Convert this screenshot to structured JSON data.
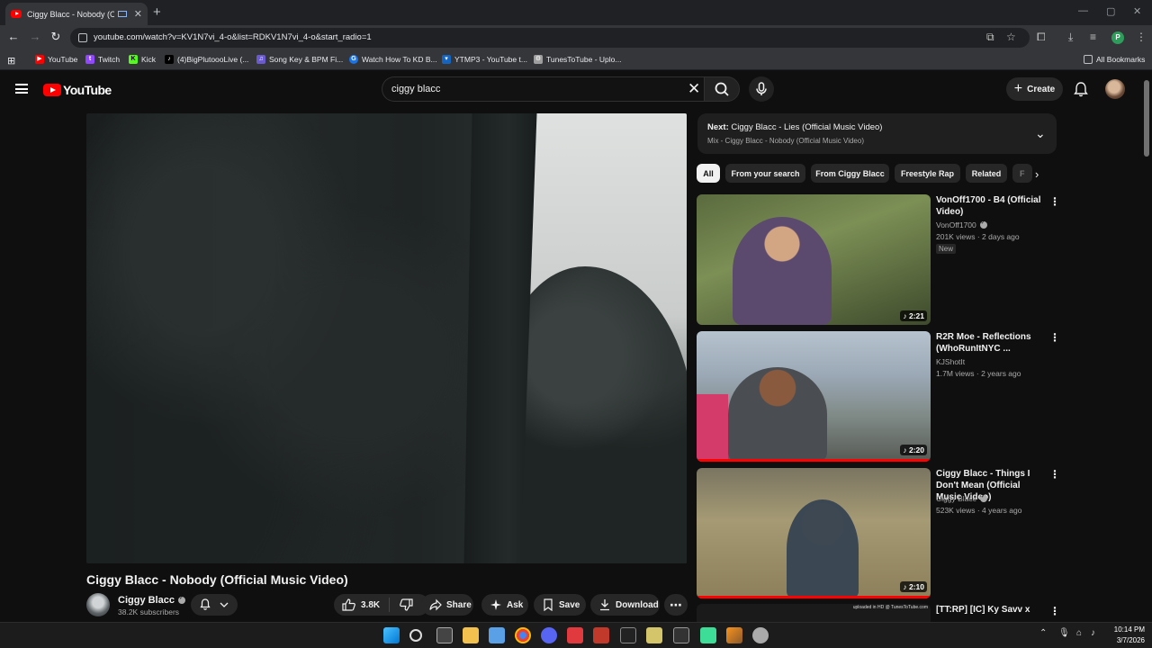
{
  "browser": {
    "tab_title": "Ciggy Blacc - Nobody (Offi",
    "url": "youtube.com/watch?v=KV1N7vi_4-o&list=RDKV1N7vi_4-o&start_radio=1",
    "profile_initial": "P",
    "bookmarks": [
      {
        "label": "YouTube",
        "icon": "youtube-icon",
        "color": "#ff0000"
      },
      {
        "label": "Twitch",
        "icon": "twitch-icon",
        "color": "#9146ff"
      },
      {
        "label": "Kick",
        "icon": "kick-icon",
        "color": "#53fc18"
      },
      {
        "label": "(4)BigPlutoooLive (...",
        "icon": "tiktok-icon",
        "color": "#000000"
      },
      {
        "label": "Song Key & BPM Fi...",
        "icon": "music-note-icon",
        "color": "#6a5acd"
      },
      {
        "label": "Watch How To KD B...",
        "icon": "globe-icon",
        "color": "#1a73e8"
      },
      {
        "label": "YTMP3 - YouTube t...",
        "icon": "ytmp3-icon",
        "color": "#1565c0"
      },
      {
        "label": "TunesToTube - Uplo...",
        "icon": "gear-icon",
        "color": "#9e9e9e"
      }
    ],
    "all_bookmarks": "All Bookmarks"
  },
  "masthead": {
    "logo_text": "YouTube",
    "search_value": "ciggy blacc",
    "create_label": "Create"
  },
  "video": {
    "title": "Ciggy Blacc - Nobody (Official Music Video)",
    "channel": "Ciggy Blacc",
    "subscribers": "38.2K subscribers",
    "likes": "3.8K",
    "actions": {
      "share": "Share",
      "ask": "Ask",
      "save": "Save",
      "download": "Download"
    }
  },
  "up_next": {
    "label": "Next:",
    "title": "Ciggy Blacc - Lies (Official Music Video)",
    "playlist": "Mix - Ciggy Blacc - Nobody (Official Music Video)"
  },
  "chips": [
    "All",
    "From your search",
    "From Ciggy Blacc",
    "Freestyle Rap",
    "Related",
    "F"
  ],
  "related": [
    {
      "title": "VonOff1700 - B4 (Official Video)",
      "channel": "VonOff1700",
      "verified": true,
      "meta": "201K views · 2 days ago",
      "badge": "New",
      "duration": "2:21"
    },
    {
      "title": "R2R Moe - Reflections (WhoRunItNYC ...",
      "channel": "KJShotIt",
      "verified": false,
      "meta": "1.7M views · 2 years ago",
      "badge": "",
      "duration": "2:20"
    },
    {
      "title": "Ciggy Blacc - Things I Don't Mean (Official Music Video)",
      "channel": "Ciggy Blacc",
      "verified": true,
      "meta": "523K views · 4 years ago",
      "badge": "",
      "duration": "2:10"
    },
    {
      "title": "[TT:RP] [IC] Ky Savv x Sha",
      "channel": "",
      "verified": false,
      "meta": "",
      "badge": "",
      "duration": "",
      "watermark": "uploaded in HD @ TunesToTube.com"
    }
  ],
  "taskbar": {
    "time": "10:14 PM",
    "date": "3/7/2026"
  },
  "colors": {
    "brand_red": "#ff0000",
    "background": "#0f0f0f",
    "chip_bg": "#272727"
  }
}
